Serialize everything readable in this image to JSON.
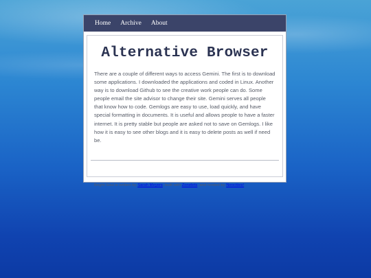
{
  "nav": {
    "items": [
      {
        "label": "Home"
      },
      {
        "label": "Archive"
      },
      {
        "label": "About"
      }
    ]
  },
  "main": {
    "title": "Alternative Browser",
    "paragraph": "There are a couple of different ways to access Gemini. The first is to download some applications. I downloaded the applications and coded in Linux. Another way is to download Github to see the creative work people can do. Some people email the site advisor to change their site. Gemini serves all people that know how to code. Gemlogs are easy to use, load quickly, and have special formatting in documents. It is useful and allows people to have a faster internet. It is pretty stable but people are asked not to save on Gemlogs. I like how it is easy to see other blogs and it is easy to delete posts as well if need be."
  },
  "footer": {
    "prefix": "Bright Soul is written by ",
    "author_link": "Sarah Meyers",
    "middle": ", built with ",
    "tool_link": "Zonelets",
    "and_hosted": ", and hosted by ",
    "host_link": "Neocities!"
  },
  "colors": {
    "nav_background": "#3b4469",
    "title": "#2b3352",
    "link": "#0000ee"
  }
}
